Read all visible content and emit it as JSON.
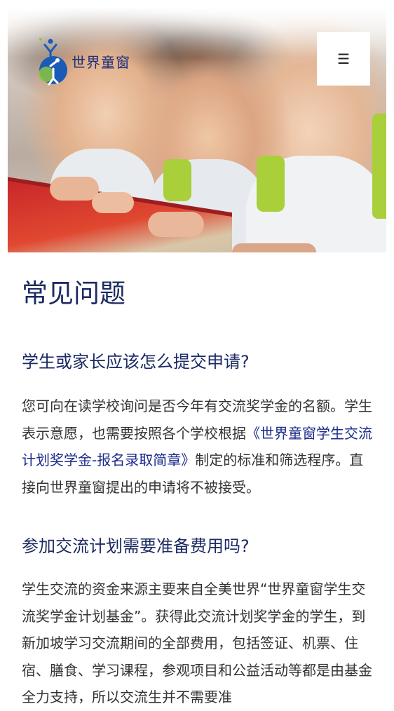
{
  "header": {
    "logo_text": "世界童窗",
    "menu_icon": "☰"
  },
  "colors": {
    "heading": "#1c2a63",
    "body_text": "#333333",
    "link": "#1c2a8a",
    "logo_blue": "#1a5bb8",
    "logo_green": "#8cc63f"
  },
  "page": {
    "title": "常见问题"
  },
  "faq": [
    {
      "question": "学生或家长应该怎么提交申请?",
      "answer_pre": "您可向在读学校询问是否今年有交流奖学金的名额。学生表示意愿，也需要按照各个学校根据",
      "answer_link": "《世界童窗学生交流计划奖学金-报名录取简章》",
      "answer_post": "制定的标准和筛选程序。直接向世界童窗提出的申请将不被接受。"
    },
    {
      "question": "参加交流计划需要准备费用吗?",
      "answer": "学生交流的资金来源主要来自全美世界“世界童窗学生交流奖学金计划基金”。获得此交流计划奖学金的学生，到新加坡学习交流期间的全部费用，包括签证、机票、住宿、膳食、学习课程，参观项目和公益活动等都是由基金全力支持，所以交流生并不需要准"
    }
  ]
}
